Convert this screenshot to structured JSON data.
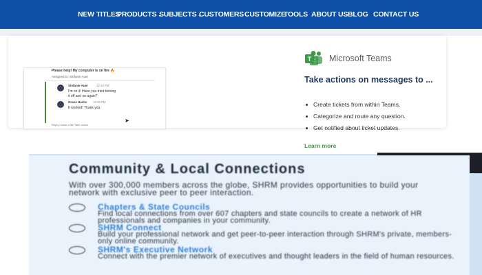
{
  "nav": {
    "items": [
      {
        "label": "NEW TITLES",
        "dropdown": false
      },
      {
        "label": "PRODUCTS",
        "dropdown": true
      },
      {
        "label": "SUBJECTS",
        "dropdown": true
      },
      {
        "label": "CUSTOMERS",
        "dropdown": true
      },
      {
        "label": "CUSTOMIZE",
        "dropdown": false
      },
      {
        "label": "TOOLS",
        "dropdown": false
      },
      {
        "label": "ABOUT US",
        "dropdown": false
      },
      {
        "label": "BLOG",
        "dropdown": false
      },
      {
        "label": "CONTACT US",
        "dropdown": false
      }
    ],
    "caret": "⌄"
  },
  "chat": {
    "title": "Please help! My computer is on fire 🔥",
    "assigned": "Assigned to: Stefanie Auer",
    "messages": [
      {
        "name": "Stefanie Auer",
        "time": "12:33 PM",
        "text_lines": [
          "I'm on it! Have you tried turning",
          "it off and on again?"
        ]
      },
      {
        "name": "Grace Harris",
        "time": "12:33 PM",
        "text_lines": [
          "It worked! Thank you."
        ]
      }
    ],
    "actions": "Reply      Leave a file      Take action"
  },
  "teams": {
    "brand": "Microsoft Teams",
    "heading": "Take actions on messages to ...",
    "bullets": [
      "Create tickets from within Teams.",
      "Categorize and route any question.",
      "Get notified about ticket updates."
    ],
    "learn_more": "Learn more",
    "brand_color": "#5b5fc7",
    "logo_color": "#3e9a4a"
  },
  "community": {
    "title": "Community & Local Connections",
    "intro": "With over 300,000 members across the globe, SHRM provides opportunities to build your network with exclusive peer to peer interaction.",
    "items": [
      {
        "title": "Chapters & State Councils",
        "desc": "Find local connections from over 607 chapters and state councils to create a network of HR professionals and companies in your community."
      },
      {
        "title": "SHRM Connect",
        "desc": "Build your professional network and get peer-to-peer interaction through SHRM's private, members-only online community."
      },
      {
        "title": "SHRM's Executive Network",
        "desc": "Connect with the premier network of executives and thought leaders in the field of human resources."
      }
    ]
  }
}
